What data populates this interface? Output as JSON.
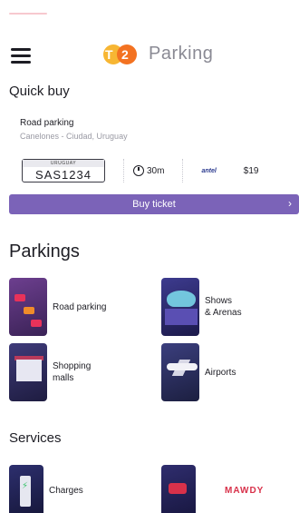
{
  "header": {
    "logo_t": "T",
    "logo_num": "2",
    "logo_text": "Parking"
  },
  "quick_buy": {
    "title": "Quick buy",
    "location": "Road parking",
    "sublocation": "Canelones - Ciudad, Uruguay",
    "plate_country": "URUGUAY",
    "plate": "SAS1234",
    "duration": "30m",
    "operator": "antel",
    "price": "$19",
    "button_label": "Buy ticket",
    "button_color": "#7b63b8"
  },
  "parkings": {
    "title": "Parkings",
    "items": [
      {
        "label": "Road parking",
        "icon": "road-parking-icon"
      },
      {
        "label_line1": "Shows",
        "label_line2": "& Arenas",
        "icon": "arena-icon"
      },
      {
        "label_line1": "Shopping",
        "label_line2": "malls",
        "icon": "shopping-mall-icon"
      },
      {
        "label": "Airports",
        "icon": "airport-icon"
      }
    ]
  },
  "services": {
    "title": "Services",
    "items": [
      {
        "label": "Charges",
        "icon": "charging-station-icon"
      },
      {
        "label": "MAWDY",
        "icon": "tow-service-icon"
      }
    ]
  },
  "colors": {
    "accent": "#7b63b8",
    "logo_yellow": "#f7b633",
    "logo_orange": "#f37221",
    "mawdy_red": "#d8314a"
  }
}
